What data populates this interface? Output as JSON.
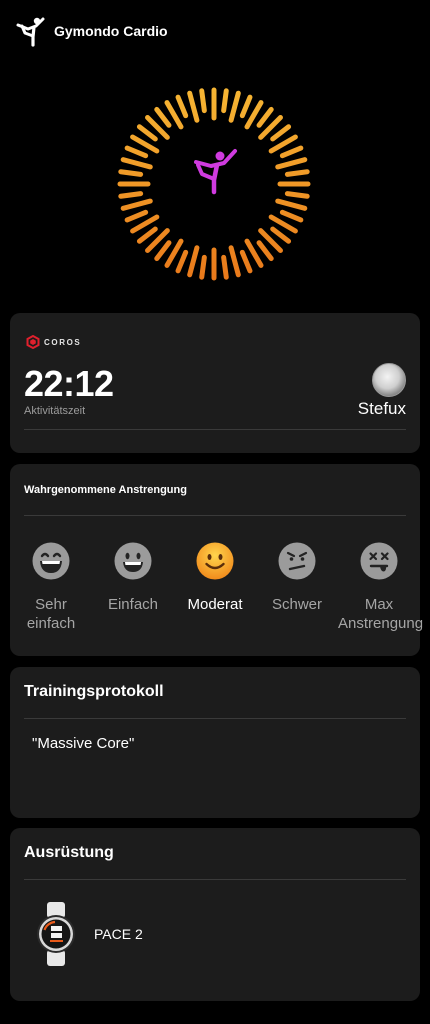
{
  "header": {
    "app_title": "Gymondo Cardio",
    "logo_icon": "yoga-figure-icon"
  },
  "hero": {
    "icon": "yoga-pose-icon",
    "ring_colors": [
      "#f6b734",
      "#e9781a"
    ],
    "figure_color": "#d03be0"
  },
  "activity": {
    "brand": "COROS",
    "brand_color": "#e0202d",
    "time": "22:12",
    "time_label": "Aktivitätszeit",
    "user": "Stefux"
  },
  "effort": {
    "title": "Wahrgenommene Anstrengung",
    "selected": "Moderat",
    "options": [
      {
        "label": "Sehr einfach",
        "icon": "laughing-face-icon"
      },
      {
        "label": "Einfach",
        "icon": "grinning-face-icon"
      },
      {
        "label": "Moderat",
        "icon": "smiling-face-icon"
      },
      {
        "label": "Schwer",
        "icon": "grimacing-face-icon"
      },
      {
        "label": "Max Anstrengung",
        "icon": "exhausted-face-icon"
      }
    ]
  },
  "protocol": {
    "title": "Trainingsprotokoll",
    "note": "\"Massive Core\""
  },
  "equipment": {
    "title": "Ausrüstung",
    "device": "PACE 2",
    "device_icon": "sports-watch-icon"
  }
}
